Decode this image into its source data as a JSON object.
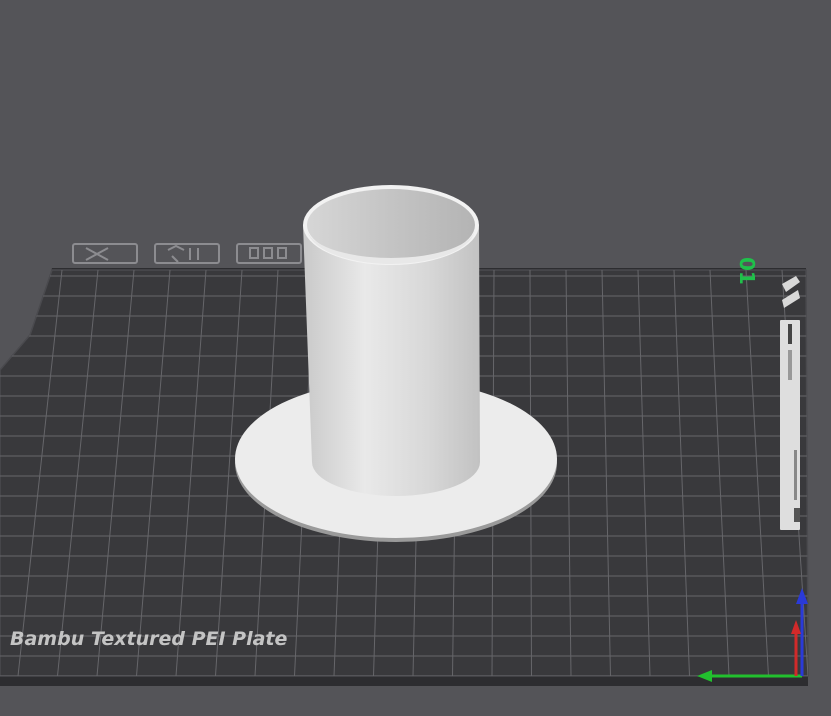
{
  "viewport": {
    "plate_label": "Bambu Textured PEI Plate",
    "plate_number": "01"
  },
  "colors": {
    "background": "#545458",
    "plate": "#39393c",
    "grid": "#6a6a6e",
    "model": "#e6e6e6",
    "plate_number": "#1fc14a",
    "axis_x": "#d22a2a",
    "axis_y": "#22c02e",
    "axis_z": "#2a3ad8"
  },
  "icons": [
    "delete-plate-icon",
    "auto-arrange-icon",
    "plate-settings-icon",
    "plate-lock-icon"
  ]
}
